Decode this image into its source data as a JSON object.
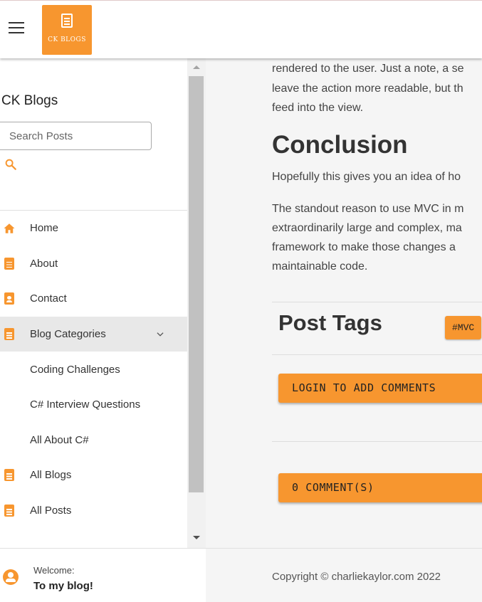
{
  "header": {
    "logo_text": "CK BLOGS"
  },
  "sidebar": {
    "title": "CK Blogs",
    "search_placeholder": "Search Posts",
    "items": [
      {
        "label": "Home"
      },
      {
        "label": "About"
      },
      {
        "label": "Contact"
      },
      {
        "label": "Blog Categories"
      },
      {
        "label": "Coding Challenges"
      },
      {
        "label": "C# Interview Questions"
      },
      {
        "label": "All About C#"
      },
      {
        "label": "All Blogs"
      },
      {
        "label": "All Posts"
      }
    ],
    "footer": {
      "welcome": "Welcome:",
      "message": "To my blog!"
    }
  },
  "main": {
    "intro_lines": [
      "rendered to the user. Just a note, a se",
      "leave the action more readable, but th",
      "feed into the view."
    ],
    "conclusion_heading": "Conclusion",
    "conclusion_line": "Hopefully this gives you an idea of ho",
    "standout_lines": [
      "The standout reason to use MVC in m",
      "extraordinarily large and complex, ma",
      "framework to make those changes a",
      "maintainable code."
    ],
    "post_tags_heading": "Post Tags",
    "tag": "#MVC",
    "login_button": "LOGIN TO ADD COMMENTS",
    "comments_button": "0 COMMENT(S)",
    "copyright": "Copyright © charliekaylor.com 2022"
  },
  "colors": {
    "accent": "#f7962f"
  }
}
